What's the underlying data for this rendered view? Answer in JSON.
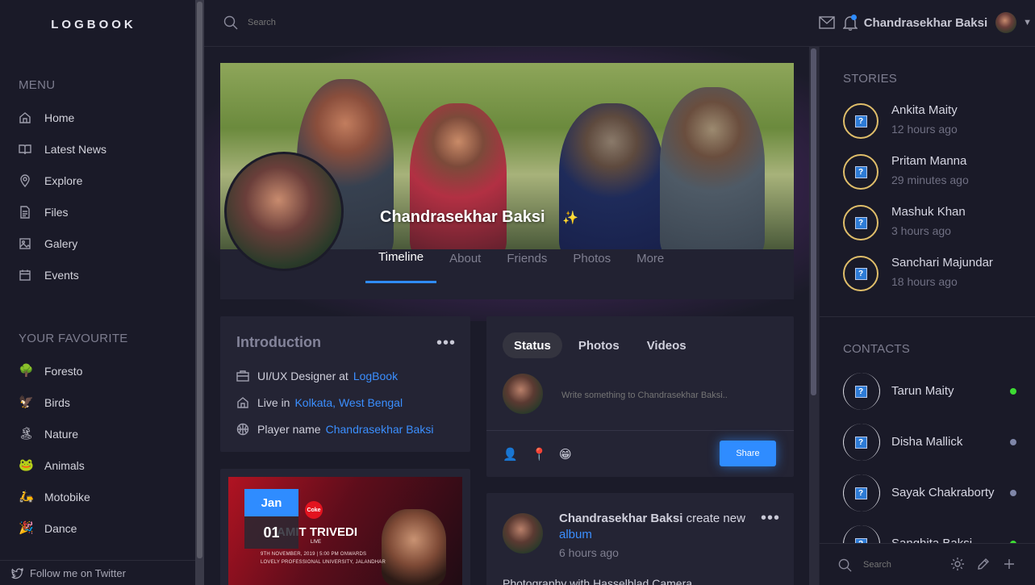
{
  "app": {
    "logo": "LOGBOOK"
  },
  "left": {
    "menu_title": "MENU",
    "menu": [
      {
        "label": "Home",
        "icon": "home-icon"
      },
      {
        "label": "Latest News",
        "icon": "book-icon"
      },
      {
        "label": "Explore",
        "icon": "map-pin-icon"
      },
      {
        "label": "Files",
        "icon": "file-icon"
      },
      {
        "label": "Galery",
        "icon": "image-icon"
      },
      {
        "label": "Events",
        "icon": "calendar-icon"
      }
    ],
    "fav_title": "YOUR FAVOURITE",
    "favourites": [
      {
        "label": "Foresto",
        "emoji": "🌳"
      },
      {
        "label": "Birds",
        "emoji": "🦅"
      },
      {
        "label": "Nature",
        "emoji": "🏝"
      },
      {
        "label": "Animals",
        "emoji": "🐸"
      },
      {
        "label": "Motobike",
        "emoji": "🛵"
      },
      {
        "label": "Dance",
        "emoji": "🎉"
      }
    ],
    "footer": "Follow me on Twitter"
  },
  "topbar": {
    "search_placeholder": "Search",
    "user_name": "Chandrasekhar Baksi"
  },
  "profile": {
    "name": "Chandrasekhar Baksi",
    "tabs": [
      "Timeline",
      "About",
      "Friends",
      "Photos",
      "More"
    ],
    "active_tab": "Timeline"
  },
  "intro": {
    "title": "Introduction",
    "rows": [
      {
        "icon": "briefcase-icon",
        "text": "UI/UX Designer at",
        "link": "LogBook"
      },
      {
        "icon": "home-icon",
        "text": "Live in",
        "link": "Kolkata, West Bengal"
      },
      {
        "icon": "basketball-icon",
        "text": "Player name",
        "link": "Chandrasekhar Baksi"
      }
    ]
  },
  "event": {
    "month": "Jan",
    "day": "01",
    "title": "AMIT TRIVEDI",
    "live": "LIVE",
    "date_line": "9TH NOVEMBER, 2019  |  5:00 PM ONWARDS",
    "venue": "LOVELY PROFESSIONAL UNIVERSITY, JALANDHAR"
  },
  "composer": {
    "tabs": [
      "Status",
      "Photos",
      "Videos"
    ],
    "active_tab": "Status",
    "placeholder": "Write something to Chandrasekhar Baksi..",
    "share_label": "Share"
  },
  "post": {
    "author": "Chandrasekhar Baksi",
    "action": "create new",
    "link": "album",
    "time": "6 hours ago",
    "text": "Photography with Hasselblad Camera"
  },
  "right": {
    "stories_title": "STORIES",
    "stories": [
      {
        "name": "Ankita Maity",
        "time": "12 hours ago"
      },
      {
        "name": "Pritam Manna",
        "time": "29 minutes ago"
      },
      {
        "name": "Mashuk Khan",
        "time": "3 hours ago"
      },
      {
        "name": "Sanchari Majundar",
        "time": "18 hours ago"
      }
    ],
    "contacts_title": "CONTACTS",
    "contacts": [
      {
        "name": "Tarun Maity",
        "status_color": "#3ddc33"
      },
      {
        "name": "Disha Mallick",
        "status_color": "#7f86a8"
      },
      {
        "name": "Sayak Chakraborty",
        "status_color": "#7f86a8"
      },
      {
        "name": "Sanghita Baksi",
        "status_color": "#3ddc33"
      }
    ],
    "search_placeholder": "Search"
  },
  "colors": {
    "accent": "#2f8cff",
    "background": "#1b1b29",
    "story_ring": "#e0be6a"
  }
}
